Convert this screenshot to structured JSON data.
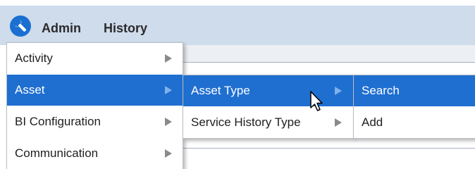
{
  "topbar": {
    "logo_icon": "wrench-icon",
    "admin_label": "Admin",
    "history_label": "History"
  },
  "menu": {
    "items": [
      {
        "label": "Activity"
      },
      {
        "label": "Asset"
      },
      {
        "label": "BI Configuration"
      },
      {
        "label": "Communication"
      }
    ]
  },
  "submenu_asset": {
    "items": [
      {
        "label": "Asset Type"
      },
      {
        "label": "Service History Type"
      }
    ]
  },
  "submenu_asset_type": {
    "items": [
      {
        "label": "Search"
      },
      {
        "label": "Add"
      }
    ]
  },
  "colors": {
    "topbar_bg": "#cfdcec",
    "highlight": "#1f6fd0",
    "logo": "#1a6fd1"
  }
}
